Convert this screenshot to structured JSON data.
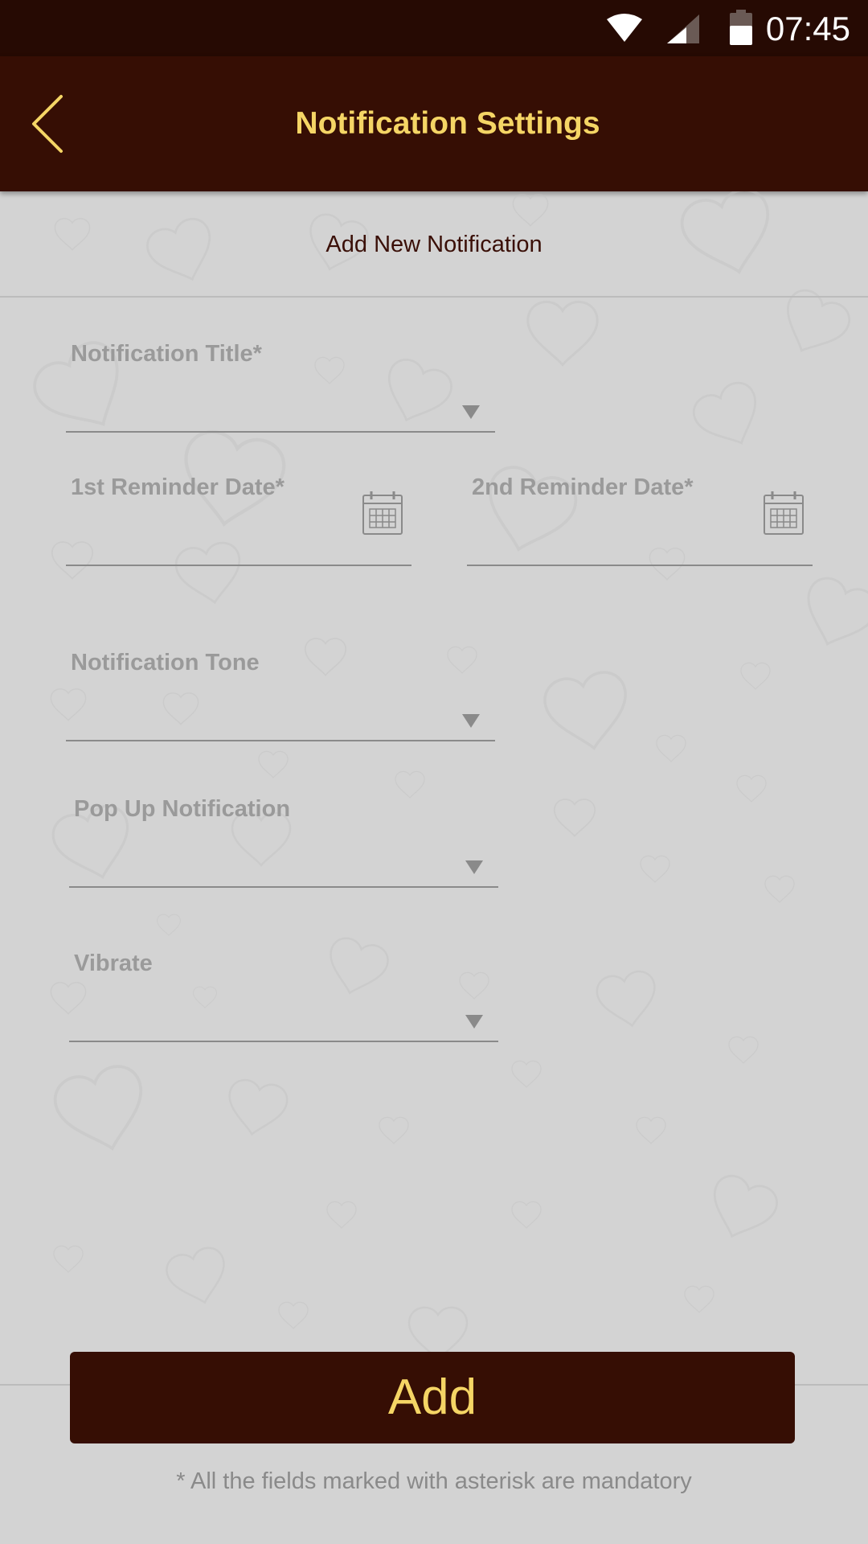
{
  "status_bar": {
    "time": "07:45",
    "icons": [
      "wifi-icon",
      "cell-signal-icon",
      "battery-icon"
    ]
  },
  "app_bar": {
    "title": "Notification Settings",
    "back_icon": "chevron-left-icon"
  },
  "form": {
    "subtitle": "Add New Notification",
    "notification_title": {
      "label": "Notification Title*",
      "value": ""
    },
    "first_reminder_date": {
      "label": "1st Reminder Date*",
      "value": "",
      "icon": "calendar-icon"
    },
    "second_reminder_date": {
      "label": "2nd Reminder Date*",
      "value": "",
      "icon": "calendar-icon"
    },
    "notification_tone": {
      "label": "Notification Tone",
      "value": ""
    },
    "popup_notification": {
      "label": "Pop Up Notification",
      "value": ""
    },
    "vibrate": {
      "label": "Vibrate",
      "value": ""
    }
  },
  "add_button_label": "Add",
  "footnote": "* All the fields marked with asterisk are mandatory",
  "colors": {
    "app_bar": "#360e04",
    "status_bar": "#260a03",
    "accent_text": "#f5d565",
    "background": "#d3d3d3"
  }
}
